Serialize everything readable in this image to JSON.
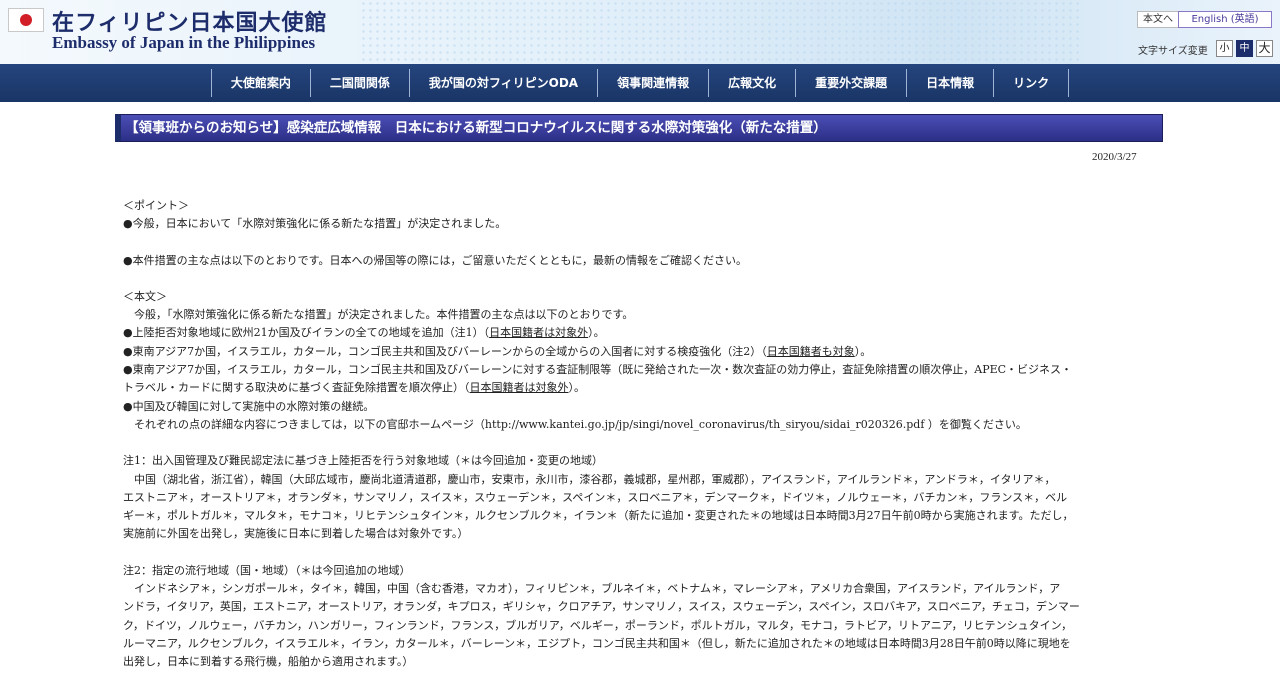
{
  "header": {
    "title_ja": "在フィリピン日本国大使館",
    "title_en": "Embassy of Japan in the Philippines",
    "lang_ja_button": "本文へ",
    "lang_en_button": "English (英語)",
    "font_size_label": "文字サイズ変更",
    "font_size_small": "小",
    "font_size_medium": "中",
    "font_size_large": "大"
  },
  "nav": {
    "items": [
      {
        "label": "大使館案内"
      },
      {
        "label": "二国間関係"
      },
      {
        "label": "我が国の対フィリピンODA"
      },
      {
        "label": "領事関連情報"
      },
      {
        "label": "広報文化"
      },
      {
        "label": "重要外交課題"
      },
      {
        "label": "日本情報"
      },
      {
        "label": "リンク"
      }
    ]
  },
  "article": {
    "title": "【領事班からのお知らせ】感染症広域情報　日本における新型コロナウイルスに関する水際対策強化（新たな措置）",
    "date": "2020/3/27",
    "point_heading": "＜ポイント＞",
    "point_1": "●今般，日本において「水際対策強化に係る新たな措置」が決定されました。",
    "point_2": "●本件措置の主な点は以下のとおりです。日本への帰国等の際には，ご留意いただくとともに，最新の情報をご確認ください。",
    "body_heading": "＜本文＞",
    "body_intro": "　今般，「水際対策強化に係る新たな措置」が決定されました。本件措置の主な点は以下のとおりです。",
    "bullet_1_text": "●上陸拒否対象地域に欧州21か国及びイランの全ての地域を追加（注1）（",
    "bullet_1_link": "日本国籍者は対象外",
    "bullet_1_end": "）。",
    "bullet_2_text": "●東南アジア7か国，イスラエル，カタール，コンゴ民主共和国及びバーレーンからの全域からの入国者に対する検疫強化（注2）（",
    "bullet_2_link": "日本国籍者も対象",
    "bullet_2_end": "）。",
    "bullet_3_line1": "●東南アジア7か国，イスラエル，カタール，コンゴ民主共和国及びバーレーンに対する査証制限等（既に発給された一次・数次査証の効力停止，査証免除措置の順次停止，APEC・ビジネス・",
    "bullet_3_line2_text": "トラベル・カードに関する取決めに基づく査証免除措置を順次停止）（",
    "bullet_3_link": "日本国籍者は対象外",
    "bullet_3_end": "）。",
    "bullet_4": "●中国及び韓国に対して実施中の水際対策の継続。",
    "details": "　それぞれの点の詳細な内容につきましては，以下の官邸ホームページ（http://www.kantei.go.jp/jp/singi/novel_coronavirus/th_siryou/sidai_r020326.pdf ）を御覧ください。",
    "note1_heading": "注1：出入国管理及び難民認定法に基づき上陸拒否を行う対象地域（＊は今回追加・変更の地域）",
    "note1_l1": "　中国（湖北省，浙江省），韓国（大邱広域市，慶尚北道清道郡，慶山市，安東市，永川市，漆谷郡，義城郡，星州郡，軍威郡），アイスランド，アイルランド＊，アンドラ＊，イタリア＊，",
    "note1_l2": "エストニア＊，オーストリア＊，オランダ＊，サンマリノ，スイス＊，スウェーデン＊，スペイン＊，スロベニア＊，デンマーク＊，ドイツ＊，ノルウェー＊，バチカン＊，フランス＊，ベル",
    "note1_l3": "ギー＊，ポルトガル＊，マルタ＊，モナコ＊，リヒテンシュタイン＊，ルクセンブルク＊，イラン＊（新たに追加・変更された＊の地域は日本時間3月27日午前0時から実施されます。ただし，",
    "note1_l4": "実施前に外国を出発し，実施後に日本に到着した場合は対象外です。）",
    "note2_heading": "注2：指定の流行地域（国・地域）（＊は今回追加の地域）",
    "note2_l1": "　インドネシア＊，シンガポール＊，タイ＊，韓国，中国（含む香港，マカオ），フィリピン＊，ブルネイ＊，ベトナム＊，マレーシア＊，アメリカ合衆国，アイスランド，アイルランド，ア",
    "note2_l2": "ンドラ，イタリア，英国，エストニア，オーストリア，オランダ，キプロス，ギリシャ，クロアチア，サンマリノ，スイス，スウェーデン，スペイン，スロバキア，スロベニア，チェコ，デンマー",
    "note2_l3": "ク，ドイツ，ノルウェー，バチカン，ハンガリー，フィンランド，フランス，ブルガリア，ベルギー，ポーランド，ポルトガル，マルタ，モナコ，ラトビア，リトアニア，リヒテンシュタイン，",
    "note2_l4": "ルーマニア，ルクセンブルク，イスラエル＊，イラン，カタール＊，バーレーン＊，エジプト，コンゴ民主共和国＊（但し，新たに追加された＊の地域は日本時間3月28日午前0時以降に現地を",
    "note2_l5": "出発し，日本に到着する飛行機，船舶から適用されます。）"
  }
}
